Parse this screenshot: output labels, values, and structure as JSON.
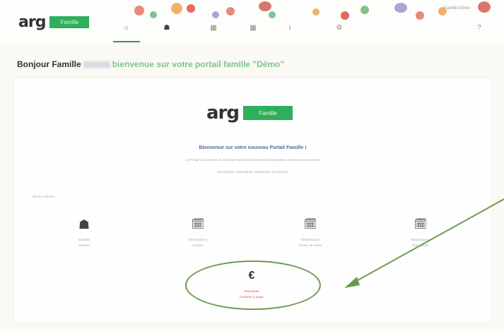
{
  "app": {
    "logo_text": "arg",
    "logo_badge": "Famille"
  },
  "nav": {
    "items": [
      {
        "icon": "home-icon",
        "glyph": "⌂"
      },
      {
        "icon": "bear-icon",
        "glyph": "☗"
      },
      {
        "icon": "calendar-icon",
        "glyph": "▦"
      },
      {
        "icon": "calendar-icon",
        "glyph": "▦"
      },
      {
        "icon": "info-icon",
        "glyph": "i"
      },
      {
        "icon": "settings-icon",
        "glyph": "⚙"
      },
      {
        "icon": "help-icon",
        "glyph": "?"
      }
    ],
    "user_name": "Famille Démo"
  },
  "greeting": {
    "prefix": "Bonjour Famille",
    "welcome": "bienvenue sur votre portail famille \"Démo\""
  },
  "card": {
    "heading": "Bienvenue sur votre nouveau Portail Famille !",
    "line1": "Le Portail vous permet de consulter toutes les informations importantes concernant votre enfant",
    "line2": "(inscriptions, réservations, paiements, documents)",
    "section_label": "Accès rapides",
    "tiles": [
      {
        "icon": "bear-icon",
        "glyph": "☗",
        "label": "Activités",
        "sub": "Enfants"
      },
      {
        "icon": "calendar-check-icon",
        "glyph": "🗓",
        "label": "Réservations",
        "sub": "Cantine"
      },
      {
        "icon": "calendar-check-icon",
        "glyph": "🗓",
        "label": "Réservations",
        "sub": "Centre de loisirs"
      },
      {
        "icon": "calendar-check-icon",
        "glyph": "🗓",
        "label": "Réservations",
        "sub": "Périscolaire"
      }
    ],
    "payment": {
      "icon": "euro-icon",
      "glyph": "€",
      "label": "Paiements",
      "sub": "Factures à payer"
    }
  },
  "colors": {
    "accent": "#2f9d58",
    "annotation": "#6d9a4e",
    "alert": "#e06050"
  }
}
